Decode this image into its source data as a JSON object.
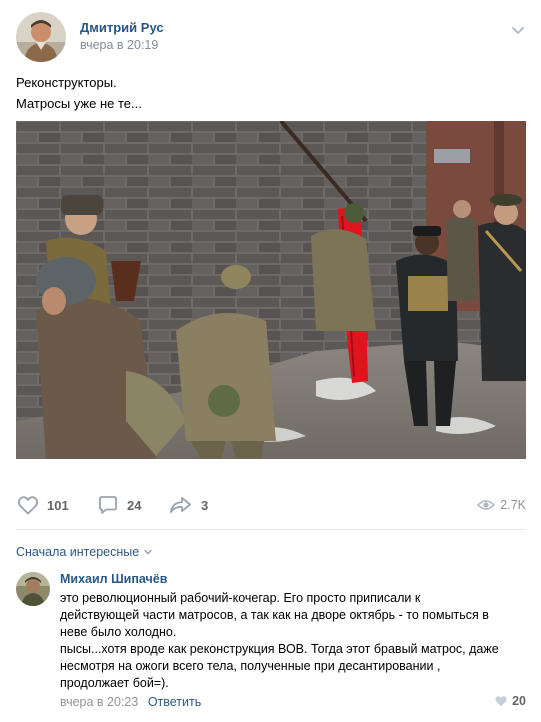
{
  "post": {
    "author": "Дмитрий Рус",
    "time": "вчера в 20:19",
    "text_lines": [
      "Реконструкторы.",
      "Матросы уже не те..."
    ]
  },
  "actions": {
    "likes": "101",
    "comments": "24",
    "shares": "3",
    "views": "2.7K"
  },
  "comments_section": {
    "sort_label": "Сначала интересные"
  },
  "comment": {
    "author": "Михаил Шипачёв",
    "text_lines": [
      "это революционный рабочий-кочегар. Его просто приписали к",
      "действующей части матросов, а так как на дворе октябрь - то помыться в",
      "неве было холодно.",
      "пысы...хотя вроде как реконструкция ВОВ. Тогда этот бравый матрос, даже",
      "несмотря на ожоги всего тела, полученные при десантировании ,",
      "продолжает бой=)."
    ],
    "time": "вчера в 20:23",
    "reply_label": "Ответить",
    "likes": "20"
  },
  "colors": {
    "link": "#2a5885",
    "meta": "#939393",
    "divider": "#e7e8ec",
    "flag": "#e0141c"
  },
  "icons": [
    "chevron-down-icon",
    "heart-icon",
    "comment-icon",
    "share-icon",
    "eye-icon"
  ]
}
